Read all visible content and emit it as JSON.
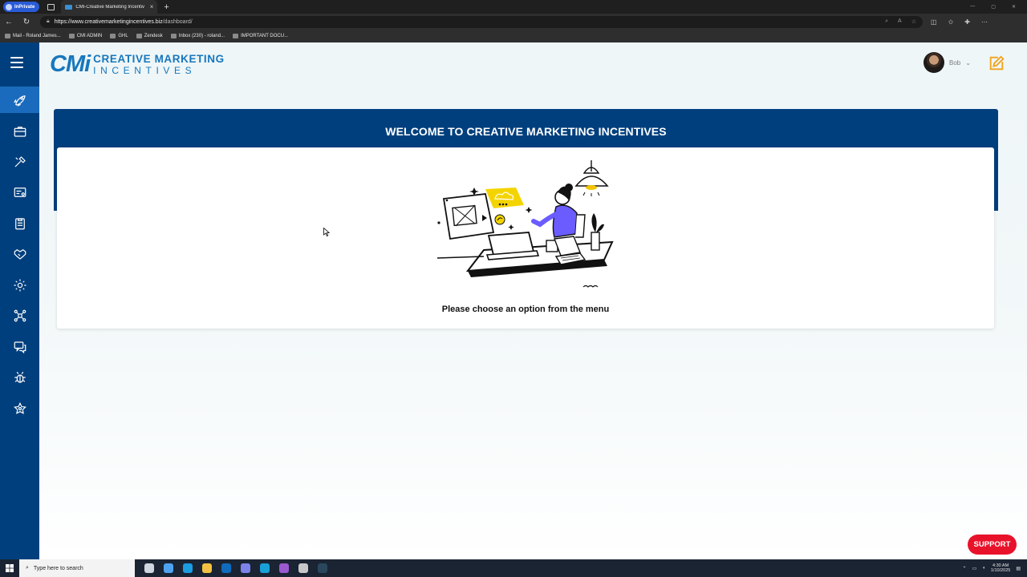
{
  "browser": {
    "inprivate_label": "InPrivate",
    "tab_title": "CMI-Creative Marketing Incentiv",
    "new_tab": "+",
    "url_host": "https://www.creativemarketingincentives.biz",
    "url_path": "/dashboard/",
    "bookmarks": [
      {
        "label": "Mail - Roland James..."
      },
      {
        "label": "CMI ADMIN"
      },
      {
        "label": "GHL"
      },
      {
        "label": "Zendesk"
      },
      {
        "label": "Inbox (230) - roland..."
      },
      {
        "label": "IMPORTANT DOCU..."
      }
    ]
  },
  "app": {
    "logo_mark": "CMi",
    "logo_line1": "CREATIVE MARKETING",
    "logo_line2": "INCENTIVES",
    "user_name": "Bob",
    "welcome_title": "WELCOME TO CREATIVE MARKETING INCENTIVES",
    "card_message": "Please choose an option from the menu",
    "support_label": "SUPPORT",
    "sidebar_icons": [
      "rocket-icon",
      "briefcase-icon",
      "tools-icon",
      "id-card-icon",
      "clipboard-list-icon",
      "handshake-icon",
      "gear-icon",
      "network-icon",
      "chat-support-icon",
      "bug-icon",
      "star-icon"
    ],
    "colors": {
      "sidebar": "#003f7d",
      "sidebar_active": "#1a6bbd",
      "brand": "#1777bd",
      "support": "#e8122a"
    }
  },
  "taskbar": {
    "search_placeholder": "Type here to search",
    "time": "4:30 AM",
    "date": "1/10/2025"
  }
}
